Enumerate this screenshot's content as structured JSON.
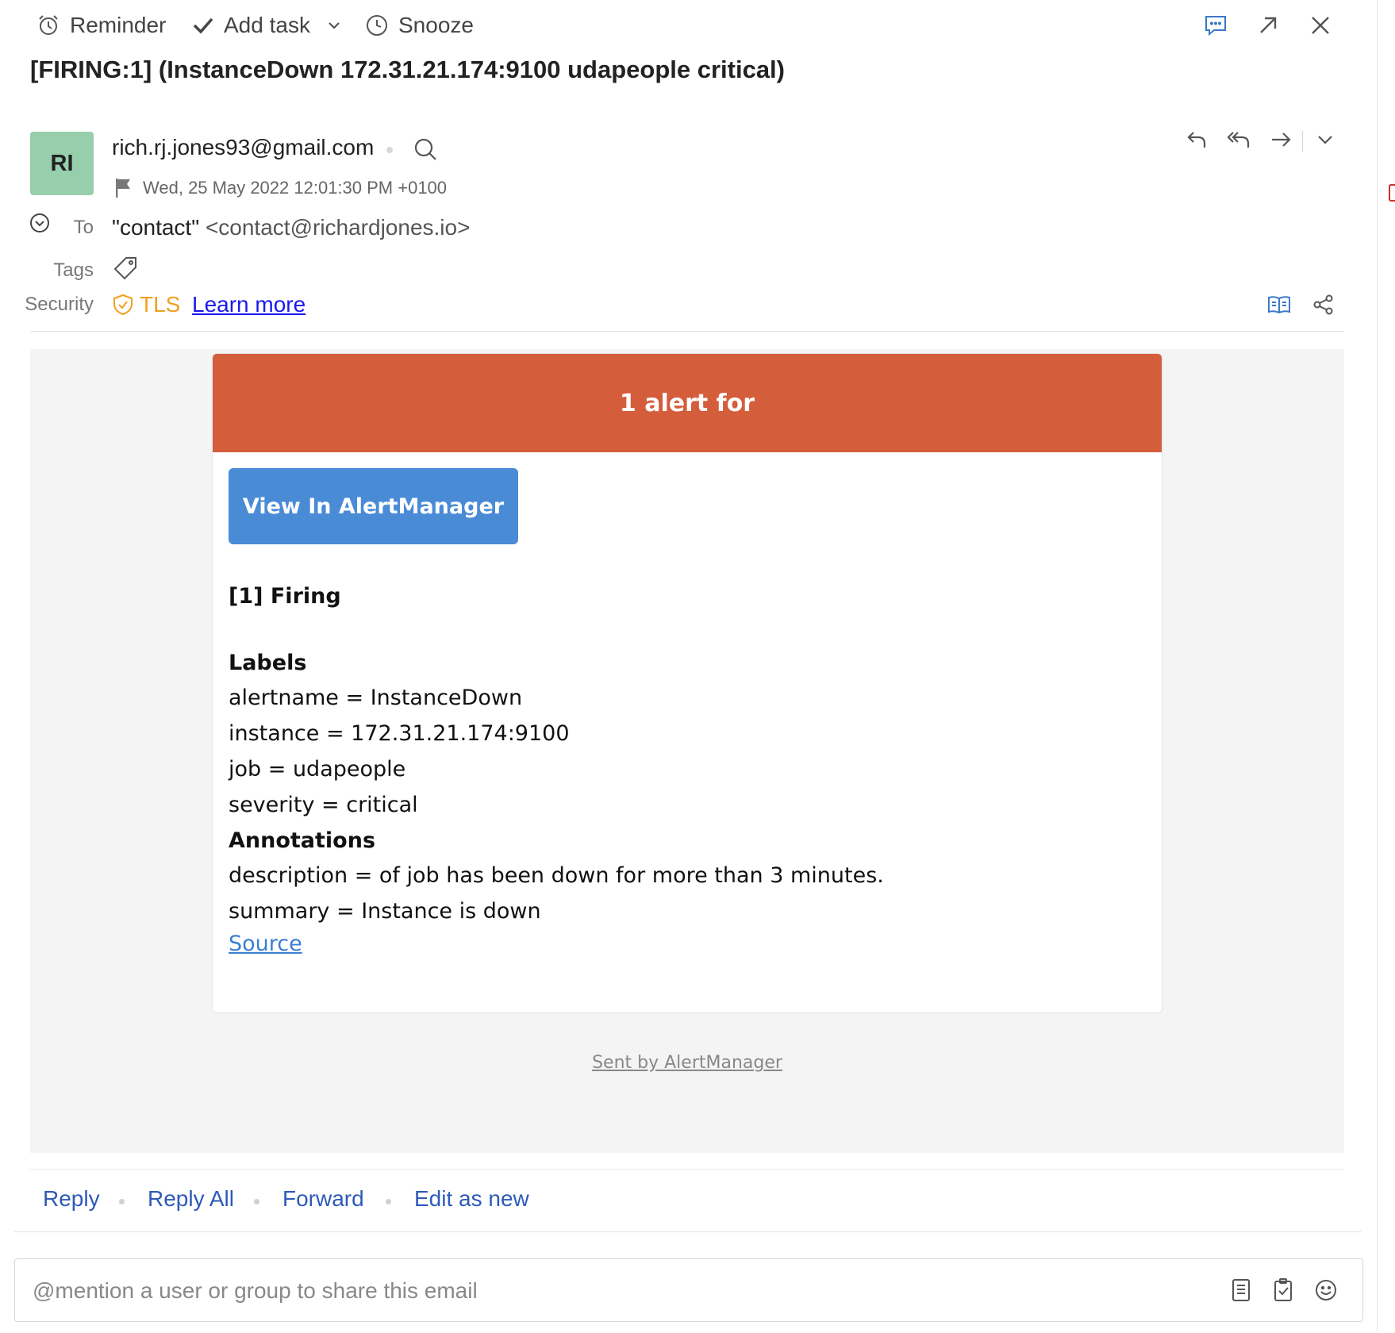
{
  "toolbar": {
    "reminder_label": "Reminder",
    "add_task_label": "Add task",
    "snooze_label": "Snooze"
  },
  "subject": "[FIRING:1]  (InstanceDown 172.31.21.174:9100 udapeople critical)",
  "sender": {
    "avatar_initials": "RI",
    "avatar_color": "#97cfac",
    "email": "rich.rj.jones93@gmail.com",
    "date": "Wed, 25 May 2022 12:01:30 PM +0100"
  },
  "headers": {
    "to_label": "To",
    "to_name": "\"contact\"",
    "to_address": "<contact@richardjones.io>",
    "tags_label": "Tags",
    "security_label": "Security",
    "tls_label": "TLS",
    "learn_more": "Learn more"
  },
  "alert_email": {
    "header_text": "1 alert for",
    "header_color": "#d45d3c",
    "button_label": "View In AlertManager",
    "button_color": "#4a8bd6",
    "firing_title": "[1] Firing",
    "labels_title": "Labels",
    "labels": [
      "alertname = InstanceDown",
      "instance = 172.31.21.174:9100",
      "job = udapeople",
      "severity = critical"
    ],
    "annotations_title": "Annotations",
    "annotations": [
      "description = of job has been down for more than 3 minutes.",
      "summary = Instance is down"
    ],
    "source_link": "Source",
    "footer": "Sent by AlertManager"
  },
  "actions": {
    "reply": "Reply",
    "reply_all": "Reply All",
    "forward": "Forward",
    "edit_as_new": "Edit as new"
  },
  "mention": {
    "placeholder": "@mention a user or group to share this email"
  },
  "colors": {
    "link_blue": "#2e5ab8",
    "tls_orange": "#f0a020"
  }
}
